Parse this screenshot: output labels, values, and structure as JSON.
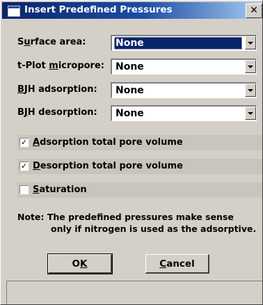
{
  "window": {
    "title": "Insert Predefined Pressures",
    "close_glyph": "✕"
  },
  "fields": {
    "surface_area": {
      "label": "Surface area:",
      "accel": "u",
      "value": "None"
    },
    "tplot": {
      "label": "t-Plot micropore:",
      "accel": "m",
      "value": "None"
    },
    "bjh_ads": {
      "label": "BJH adsorption:",
      "accel": "B",
      "value": "None"
    },
    "bjh_des": {
      "label": "BJH desorption:",
      "accel": "J",
      "value": "None"
    }
  },
  "checks": {
    "ads_total": {
      "label": "Adsorption total pore volume",
      "checked": true
    },
    "des_total": {
      "label": "Desorption total pore volume",
      "checked": true
    },
    "saturation": {
      "label": "Saturation",
      "checked": false
    }
  },
  "note": {
    "line1": "Note:  The predefined pressures make sense",
    "line2": "only if nitrogen is used as the adsorptive."
  },
  "buttons": {
    "ok": "OK",
    "cancel": "Cancel"
  },
  "colors": {
    "title_start": "#0a246a",
    "title_end": "#a6caf0",
    "face": "#d4d0c8",
    "selection": "#0a246a"
  }
}
